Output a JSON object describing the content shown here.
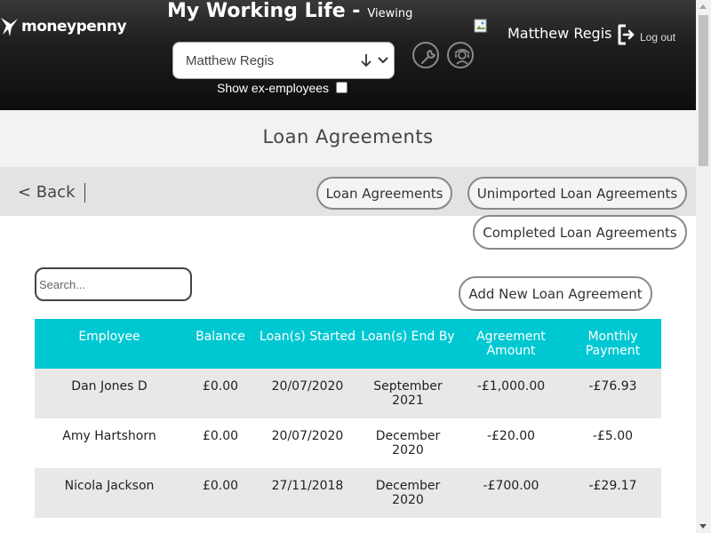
{
  "header": {
    "logo_text": "moneypenny",
    "app_title": "My Working Life -",
    "viewing_label": "Viewing",
    "employee_select": {
      "value": "Matthew Regis"
    },
    "show_ex_employees_label": "Show ex-employees",
    "user_name": "Matthew Regis",
    "logout_label": "Log out",
    "icons": [
      "wrench-icon",
      "support-icon",
      "logout-icon"
    ]
  },
  "page": {
    "title": "Loan Agreements"
  },
  "nav": {
    "back_label": "< Back",
    "tabs": [
      {
        "label": "Loan Agreements"
      },
      {
        "label": "Unimported Loan Agreements"
      },
      {
        "label": "Completed Loan Agreements"
      }
    ]
  },
  "search": {
    "placeholder": "Search..."
  },
  "add_button_label": "Add New Loan Agreement",
  "table": {
    "columns": [
      "Employee",
      "Balance",
      "Loan(s) Started",
      "Loan(s) End By",
      "Agreement Amount",
      "Monthly Payment"
    ],
    "rows": [
      {
        "employee": "Dan Jones D",
        "balance": "£0.00",
        "started": "20/07/2020",
        "end_by": "September 2021",
        "amount": "-£1,000.00",
        "monthly": "-£76.93"
      },
      {
        "employee": "Amy Hartshorn",
        "balance": "£0.00",
        "started": "20/07/2020",
        "end_by": "December 2020",
        "amount": "-£20.00",
        "monthly": "-£5.00"
      },
      {
        "employee": "Nicola Jackson",
        "balance": "£0.00",
        "started": "27/11/2018",
        "end_by": "December 2020",
        "amount": "-£700.00",
        "monthly": "-£29.17"
      }
    ]
  },
  "colors": {
    "header_bg": "#1e1e1e",
    "table_header_bg": "#00c8d2",
    "row_alt_bg": "#e8e8e8"
  }
}
